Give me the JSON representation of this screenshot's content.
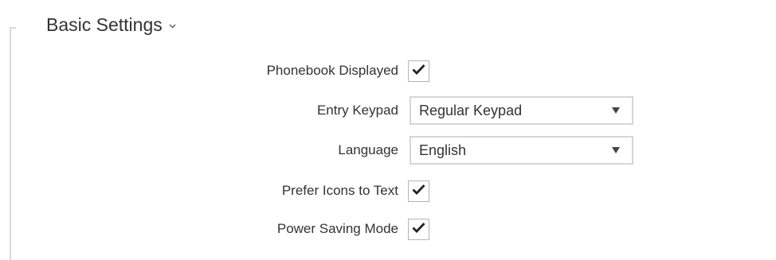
{
  "section": {
    "title": "Basic Settings"
  },
  "fields": {
    "phonebook_displayed": {
      "label": "Phonebook Displayed",
      "checked": true
    },
    "entry_keypad": {
      "label": "Entry Keypad",
      "value": "Regular Keypad"
    },
    "language": {
      "label": "Language",
      "value": "English"
    },
    "prefer_icons": {
      "label": "Prefer Icons to Text",
      "checked": true
    },
    "power_saving": {
      "label": "Power Saving Mode",
      "checked": true
    }
  },
  "icons": {
    "section_toggle": "chevron-down-icon",
    "checkbox": "checkmark-icon",
    "select": "caret-down-icon"
  },
  "colors": {
    "text": "#333333",
    "border": "#d6d6d6",
    "checkmark": "#222222"
  }
}
